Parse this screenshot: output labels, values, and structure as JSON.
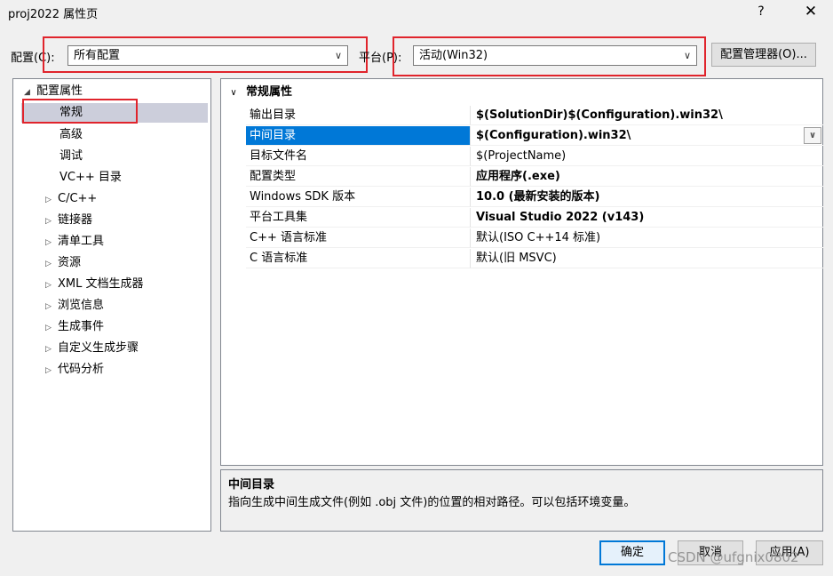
{
  "window": {
    "title": "proj2022 属性页",
    "help": "?",
    "close": "✕"
  },
  "config_bar": {
    "config_label": "配置(C):",
    "config_value": "所有配置",
    "platform_label": "平台(P):",
    "platform_value": "活动(Win32)",
    "manager_button": "配置管理器(O)..."
  },
  "tree": {
    "root": {
      "label": "配置属性",
      "toggle": "◢"
    },
    "children": [
      {
        "label": "常规",
        "toggle": ""
      },
      {
        "label": "高级",
        "toggle": ""
      },
      {
        "label": "调试",
        "toggle": ""
      },
      {
        "label": "VC++ 目录",
        "toggle": ""
      }
    ],
    "groups": [
      {
        "label": "C/C++",
        "toggle": "▷"
      },
      {
        "label": "链接器",
        "toggle": "▷"
      },
      {
        "label": "清单工具",
        "toggle": "▷"
      },
      {
        "label": "资源",
        "toggle": "▷"
      },
      {
        "label": "XML 文档生成器",
        "toggle": "▷"
      },
      {
        "label": "浏览信息",
        "toggle": "▷"
      },
      {
        "label": "生成事件",
        "toggle": "▷"
      },
      {
        "label": "自定义生成步骤",
        "toggle": "▷"
      },
      {
        "label": "代码分析",
        "toggle": "▷"
      }
    ]
  },
  "grid": {
    "section": "常规属性",
    "chevron": "∨",
    "rows": [
      {
        "name": "输出目录",
        "value": "$(SolutionDir)$(Configuration).win32\\"
      },
      {
        "name": "中间目录",
        "value": "$(Configuration).win32\\"
      },
      {
        "name": "目标文件名",
        "value": "$(ProjectName)"
      },
      {
        "name": "配置类型",
        "value": "应用程序(.exe)"
      },
      {
        "name": "Windows SDK 版本",
        "value": "10.0 (最新安装的版本)"
      },
      {
        "name": "平台工具集",
        "value": "Visual Studio 2022 (v143)"
      },
      {
        "name": "C++ 语言标准",
        "value": "默认(ISO C++14 标准)"
      },
      {
        "name": "C 语言标准",
        "value": "默认(旧 MSVC)"
      }
    ]
  },
  "description": {
    "title": "中间目录",
    "text": "指向生成中间生成文件(例如 .obj 文件)的位置的相对路径。可以包括环境变量。"
  },
  "buttons": {
    "ok": "确定",
    "cancel": "取消",
    "apply": "应用(A)"
  },
  "watermark": "CSDN @ufgnix0802",
  "icons": {
    "dropdown": "chevron-down-icon"
  },
  "colors": {
    "highlight": "#0078d7",
    "annotation_red": "#e0242c"
  }
}
